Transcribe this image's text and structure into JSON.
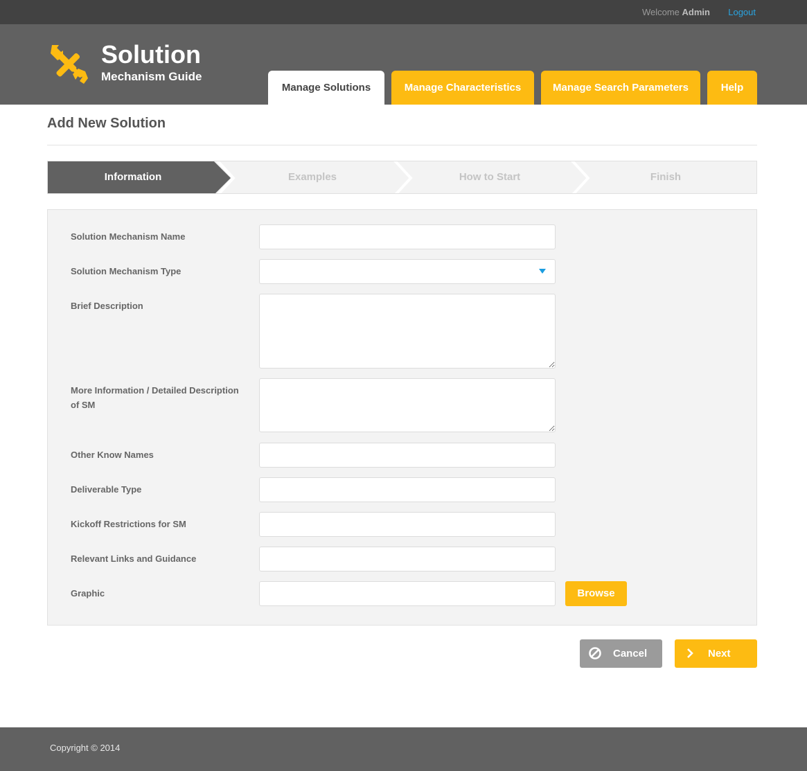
{
  "topbar": {
    "welcome_prefix": "Welcome",
    "user": "Admin",
    "logout": "Logout"
  },
  "brand": {
    "title": "Solution",
    "subtitle": "Mechanism Guide",
    "logo_icon": "wrench-screwdriver-icon"
  },
  "nav": {
    "tabs": [
      {
        "label": "Manage Solutions",
        "active": true
      },
      {
        "label": "Manage Characteristics",
        "active": false
      },
      {
        "label": "Manage Search Parameters",
        "active": false
      },
      {
        "label": "Help",
        "active": false
      }
    ]
  },
  "page": {
    "title": "Add New Solution"
  },
  "steps": [
    {
      "label": "Information",
      "active": true
    },
    {
      "label": "Examples",
      "active": false
    },
    {
      "label": "How to Start",
      "active": false
    },
    {
      "label": "Finish",
      "active": false
    }
  ],
  "form": {
    "fields": [
      {
        "label": "Solution Mechanism Name",
        "value": ""
      },
      {
        "label": "Solution Mechanism Type",
        "value": ""
      },
      {
        "label": "Brief Description",
        "value": ""
      },
      {
        "label": "More Information / Detailed Description of SM",
        "value": ""
      },
      {
        "label": "Other Know Names",
        "value": ""
      },
      {
        "label": "Deliverable Type",
        "value": ""
      },
      {
        "label": "Kickoff Restrictions for SM",
        "value": ""
      },
      {
        "label": "Relevant Links and Guidance",
        "value": ""
      },
      {
        "label": "Graphic",
        "value": ""
      }
    ],
    "browse_label": "Browse"
  },
  "actions": {
    "cancel_label": "Cancel",
    "cancel_icon": "prohibited-icon",
    "next_label": "Next",
    "next_icon": "chevron-right-icon"
  },
  "footer": {
    "copyright": "Copyright © 2014"
  },
  "colors": {
    "accent": "#fdbb12",
    "header": "#616161",
    "topbar": "#424242",
    "link": "#2aa4e0",
    "step_active": "#616161"
  }
}
